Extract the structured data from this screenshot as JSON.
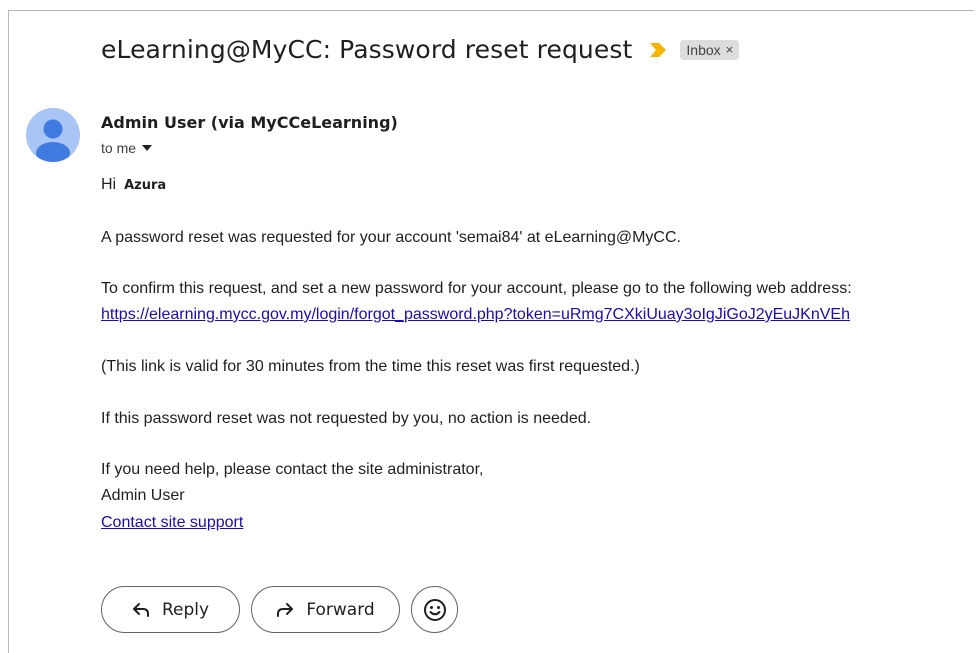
{
  "email": {
    "subject": "eLearning@MyCC: Password reset request",
    "label": "Inbox",
    "label_remove": "×",
    "sender": "Admin User (via MyCCeLearning)",
    "recipient": "to me",
    "greeting": "Hi",
    "greeting_name": "Azura",
    "para1": "A password reset was requested for your account 'semai84' at eLearning@MyCC.",
    "para2": "To confirm this request, and set a new password for your account, please go to the following web address:",
    "reset_link": "https://elearning.mycc.gov.my/login/forgot_password.php?token=uRmg7CXkiUuay3oIgJiGoJ2yEuJKnVEh",
    "para3": "(This link is valid for 30 minutes from the time this reset was first requested.)",
    "para4": "If this password reset was not requested by you, no action is needed.",
    "para5": "If you need help, please contact the site administrator,",
    "signature": "Admin User",
    "support_link": "Contact site support"
  },
  "actions": {
    "reply": "Reply",
    "forward": "Forward",
    "emoji_icon": "smiley-icon"
  },
  "colors": {
    "importance_marker": "#f4b400",
    "link": "#1a0dab",
    "avatar_bg": "#a9c5f5",
    "avatar_fg": "#3f7be0"
  }
}
